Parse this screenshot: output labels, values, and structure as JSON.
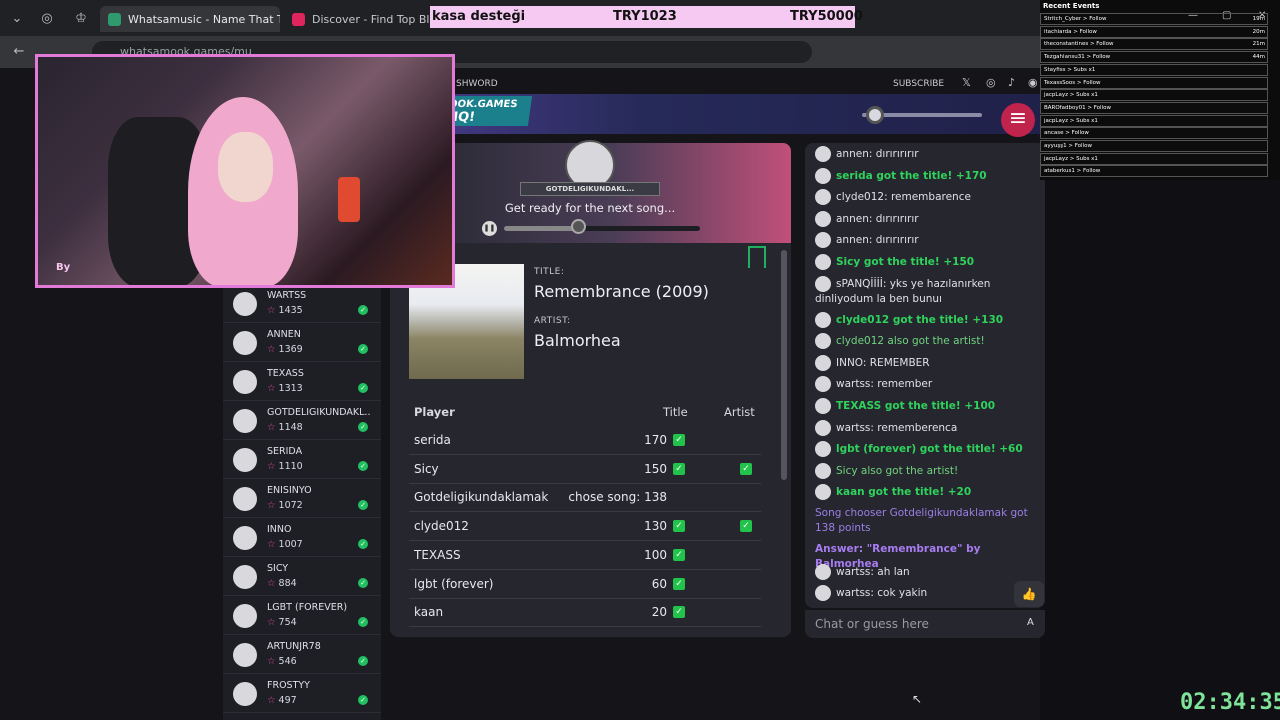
{
  "browser": {
    "tabs": [
      {
        "label": "Whatsamusic - Name That Tun",
        "active": true
      },
      {
        "label": "Discover - Find Top Blerps, S",
        "active": false
      }
    ],
    "url": "whatsamook.games/mu"
  },
  "donation": {
    "label": "kasa desteği",
    "current": "TRY1023",
    "goal": "TRY50000"
  },
  "site": {
    "nav_left": "SHWORD",
    "subscribe": "SUBSCRIBE",
    "logo_line1": "OOK.GAMES",
    "logo_line2": "HQ!",
    "menu_icon": "hamburger-icon"
  },
  "leaderboard": [
    {
      "name": "WARTSS",
      "score": "1435"
    },
    {
      "name": "ANNEN",
      "score": "1369"
    },
    {
      "name": "TEXASS",
      "score": "1313"
    },
    {
      "name": "GOTDELIGIKUNDAKL...",
      "score": "1148"
    },
    {
      "name": "SERIDA",
      "score": "1110"
    },
    {
      "name": "ENISINYO",
      "score": "1072"
    },
    {
      "name": "INNO",
      "score": "1007"
    },
    {
      "name": "SICY",
      "score": "884"
    },
    {
      "name": "LGBT (FOREVER)",
      "score": "754"
    },
    {
      "name": "ARTUNJR78",
      "score": "546"
    },
    {
      "name": "FROSTYY",
      "score": "497"
    }
  ],
  "game": {
    "chooser": "GOTDELIGIKUNDAKL...",
    "status": "Get ready for the next song...",
    "progress": 0.4,
    "title_label": "TITLE:",
    "title": "Remembrance (2009)",
    "artist_label": "ARTIST:",
    "artist": "Balmorhea",
    "table": {
      "headers": [
        "Player",
        "Title",
        "Artist"
      ],
      "rows": [
        {
          "player": "serida",
          "title": "170",
          "title_ok": true,
          "artist_ok": false
        },
        {
          "player": "Sicy",
          "title": "150",
          "title_ok": true,
          "artist_ok": true
        },
        {
          "player": "Gotdeligikundaklamak",
          "title": "chose song: 138",
          "title_ok": false,
          "artist_ok": false
        },
        {
          "player": "clyde012",
          "title": "130",
          "title_ok": true,
          "artist_ok": true
        },
        {
          "player": "TEXASS",
          "title": "100",
          "title_ok": true,
          "artist_ok": false
        },
        {
          "player": "lgbt (forever)",
          "title": "60",
          "title_ok": true,
          "artist_ok": false
        },
        {
          "player": "kaan",
          "title": "20",
          "title_ok": true,
          "artist_ok": false
        }
      ]
    }
  },
  "chat": {
    "messages": [
      {
        "text": "annen: dırırırırır",
        "style": "n",
        "avatar": true
      },
      {
        "text": "serida got the title! +170",
        "style": "g",
        "avatar": true
      },
      {
        "text": "clyde012: remembarence",
        "style": "n",
        "avatar": true
      },
      {
        "text": "annen: dırırırırır",
        "style": "n",
        "avatar": true
      },
      {
        "text": "annen: dırırırırır",
        "style": "n",
        "avatar": true
      },
      {
        "text": "Sicy got the title! +150",
        "style": "g",
        "avatar": true
      },
      {
        "text": "sPANQİİİİ: yks ye hazılanırken dinliyodum la ben bunuı",
        "style": "n",
        "avatar": true
      },
      {
        "text": "clyde012 got the title! +130",
        "style": "g",
        "avatar": true
      },
      {
        "text": "clyde012 also got the artist!",
        "style": "ga",
        "avatar": true
      },
      {
        "text": "INNO: REMEMBER",
        "style": "n",
        "avatar": true
      },
      {
        "text": "wartss: remember",
        "style": "n",
        "avatar": true
      },
      {
        "text": "TEXASS got the title! +100",
        "style": "g",
        "avatar": true
      },
      {
        "text": "wartss: rememberenca",
        "style": "n",
        "avatar": true
      },
      {
        "text": "lgbt (forever) got the title! +60",
        "style": "g",
        "avatar": true
      },
      {
        "text": "Sicy also got the artist!",
        "style": "ga",
        "avatar": true
      },
      {
        "text": "kaan got the title! +20",
        "style": "g",
        "avatar": true
      },
      {
        "text": "Song chooser Gotdeligikundaklamak got 138 points",
        "style": "pu",
        "avatar": false
      },
      {
        "text": "Answer: \"Remembrance\" by Balmorhea",
        "style": "pb",
        "avatar": false
      },
      {
        "text": "wartss: ah lan",
        "style": "n",
        "avatar": true
      },
      {
        "text": "wartss: cok yakin",
        "style": "n",
        "avatar": true
      }
    ],
    "input_placeholder": "Chat or guess here",
    "input_hint": "A"
  },
  "webcam": {
    "overlay_text": "By"
  },
  "events": {
    "title": "Recent Events",
    "items": [
      {
        "text": "Stritch_Cyber > Follow",
        "time": "19m"
      },
      {
        "text": "itachiarda > Follow",
        "time": "20m"
      },
      {
        "text": "theconstantines > Follow",
        "time": "21m"
      },
      {
        "text": "Tezgahlansu31 > Follow",
        "time": "44m"
      },
      {
        "text": "Stayfiss > Subs x1",
        "time": ""
      },
      {
        "text": "TexassSoos > Follow",
        "time": ""
      },
      {
        "text": "jacpLayz > Subs x1",
        "time": ""
      },
      {
        "text": "BAROfadboy01 > Follow",
        "time": ""
      },
      {
        "text": "jacpLayz > Subs x1",
        "time": ""
      },
      {
        "text": "ancase > Follow",
        "time": ""
      },
      {
        "text": "ayyuşş1 > Follow",
        "time": ""
      },
      {
        "text": "jacpLayz > Subs x1",
        "time": ""
      },
      {
        "text": "ataberkus1 > Follow",
        "time": ""
      }
    ]
  },
  "timer": "02:34:35",
  "colors": {
    "accent": "#e27ad8",
    "success": "#22c34a",
    "menu": "#c0234c"
  }
}
